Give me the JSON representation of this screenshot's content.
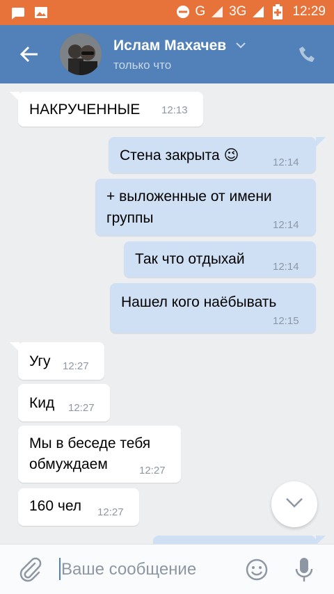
{
  "status_bar": {
    "time": "12:29",
    "network": "G",
    "network2": "3G",
    "icons": [
      "message-icon",
      "image-icon",
      "do-not-disturb-icon",
      "signal-icon",
      "battery-icon"
    ]
  },
  "header": {
    "contact_name": "Ислам Махачев",
    "status": "только что",
    "icons": [
      "back-arrow-icon",
      "chevron-down-icon",
      "phone-icon"
    ]
  },
  "messages": [
    {
      "dir": "in",
      "text": "НАКРУЧЕННЫЕ",
      "time": "12:13"
    },
    {
      "dir": "out",
      "text": "Стена закрыта 😉",
      "time": "12:14"
    },
    {
      "dir": "out",
      "text_lines": [
        "+ выложенные от имени",
        "группы"
      ],
      "time": "12:14"
    },
    {
      "dir": "out",
      "text": "Так что отдыхай",
      "time": "12:14"
    },
    {
      "dir": "out",
      "text": "Нашел кого наёбывать",
      "time": "12:15"
    },
    {
      "dir": "in",
      "text": "Угу",
      "time": "12:27"
    },
    {
      "dir": "in",
      "text": "Кид",
      "time": "12:27"
    },
    {
      "dir": "in",
      "text_lines": [
        "Мы в беседе тебя",
        "обмуждаем"
      ],
      "time": "12:27"
    },
    {
      "dir": "in",
      "text": "160 чел",
      "time": "12:27"
    }
  ],
  "composer": {
    "placeholder": "Ваше сообщение",
    "icons": [
      "attach-icon",
      "emoji-icon",
      "microphone-icon"
    ]
  },
  "colors": {
    "status_bar": "#e8733a",
    "app_bar": "#5181b8",
    "chat_background": "#edeef0",
    "incoming_bubble": "#ffffff",
    "outgoing_bubble": "#cfe0f5",
    "timestamp": "#8d97a3"
  }
}
